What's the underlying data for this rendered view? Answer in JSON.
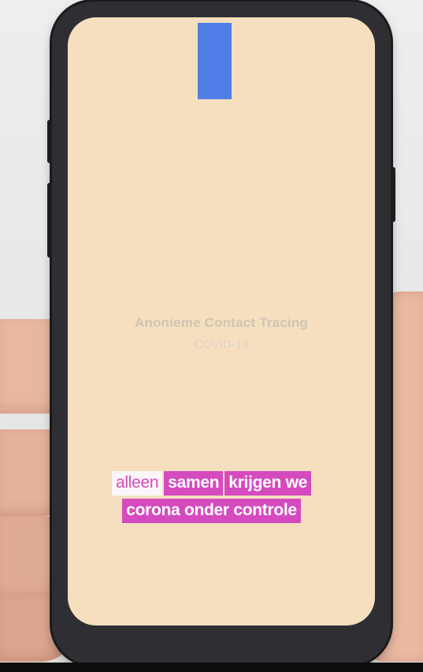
{
  "app": {
    "title": "Anonieme Contact Tracing",
    "subtitle": "COVID-19"
  },
  "captions": {
    "line1": [
      "alleen",
      "samen",
      "krijgen we"
    ],
    "line2": [
      "corona onder controle"
    ]
  },
  "colors": {
    "screen_background": "#f6dfbf",
    "indicator": "#4f7ee6",
    "caption_highlight": "#d54bbf",
    "caption_text": "#ffffff"
  }
}
